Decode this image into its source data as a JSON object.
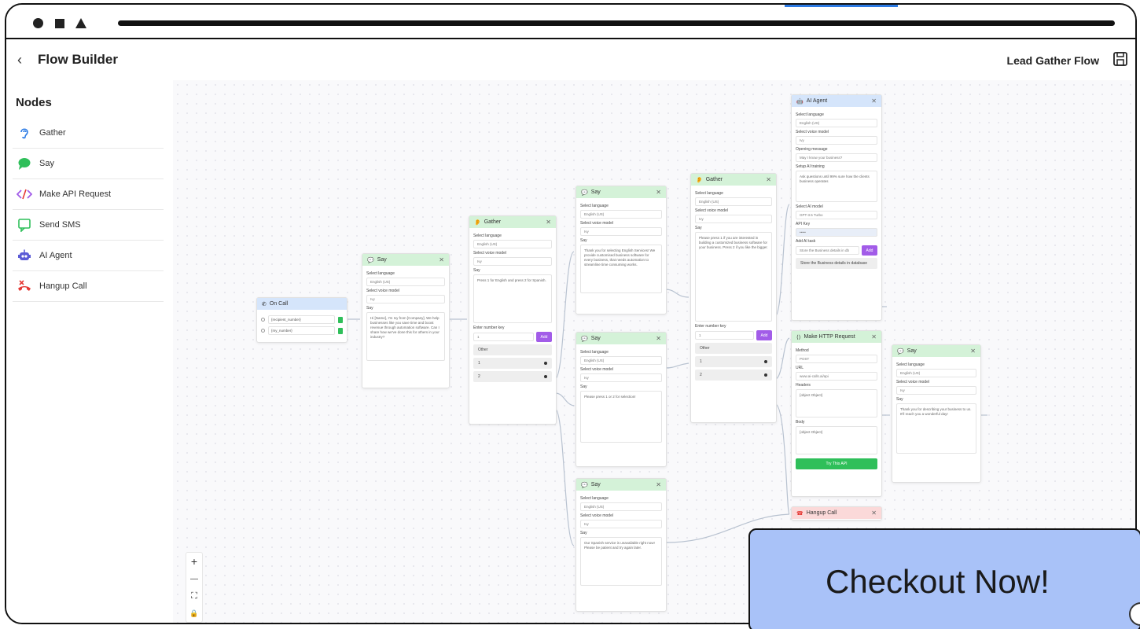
{
  "header": {
    "back_icon": "‹",
    "title": "Flow Builder",
    "flow_name": "Lead Gather Flow"
  },
  "sidebar": {
    "title": "Nodes",
    "items": [
      {
        "label": "Gather",
        "icon": "ear-icon",
        "color": "#2c7be5"
      },
      {
        "label": "Say",
        "icon": "speech-bubble-icon",
        "color": "#2fbf5a"
      },
      {
        "label": "Make API Request",
        "icon": "code-icon",
        "color": "#a25ce8"
      },
      {
        "label": "Send SMS",
        "icon": "message-icon",
        "color": "#2fbf5a"
      },
      {
        "label": "AI Agent",
        "icon": "robot-icon",
        "color": "#5b5bd6"
      },
      {
        "label": "Hangup Call",
        "icon": "hangup-icon",
        "color": "#e53935"
      }
    ]
  },
  "canvas": {
    "oncall": {
      "title": "On Call",
      "vars": [
        "{recipient_number}",
        "{my_number}"
      ]
    },
    "say1": {
      "title": "Say",
      "lang_label": "Select language",
      "lang_value": "English (US)",
      "voice_label": "Select voice model",
      "voice_value": "Ivy",
      "say_label": "Say",
      "say_text": "Hi [Name], I'm Ivy from [Company]. We help businesses like you save time and boost revenue through automation software. Can I share how we've done this for others in your industry?"
    },
    "gather1": {
      "title": "Gather",
      "lang_label": "Select language",
      "lang_value": "English (US)",
      "voice_label": "Select voice model",
      "voice_value": "Ivy",
      "say_label": "Say",
      "say_text": "Press 1 for English and press 2 for Spanish.",
      "key_label": "Enter number key",
      "key_value": "1",
      "add_label": "Add",
      "options": [
        "Other",
        "1",
        "2"
      ]
    },
    "say2": {
      "title": "Say",
      "lang_label": "Select language",
      "lang_value": "English (US)",
      "voice_label": "Select voice model",
      "voice_value": "Ivy",
      "say_label": "Say",
      "say_text": "Thank you for selecting English Services! We provide customised business software for every business, that needs automation to streamline time consuming works."
    },
    "say3": {
      "title": "Say",
      "lang_label": "Select language",
      "lang_value": "English (US)",
      "voice_label": "Select voice model",
      "voice_value": "Ivy",
      "say_label": "Say",
      "say_text": "Please press 1 or 2 for selection!"
    },
    "say4": {
      "title": "Say",
      "lang_label": "Select language",
      "lang_value": "English (US)",
      "voice_label": "Select voice model",
      "voice_value": "Ivy",
      "say_label": "Say",
      "say_text": "Our Spanish service is unavailable right now! Please be patient and try again later."
    },
    "gather2": {
      "title": "Gather",
      "lang_label": "Select language",
      "lang_value": "English (US)",
      "voice_label": "Select voice model",
      "voice_value": "Ivy",
      "say_label": "Say",
      "say_text": "Please press 1 if you are interested in building a customized business software for your business. Press 2 if you like the bigger.",
      "key_label": "Enter number key",
      "key_value": "1",
      "add_label": "Add",
      "options": [
        "Other",
        "1",
        "2"
      ]
    },
    "aiagent": {
      "title": "AI Agent",
      "lang_label": "Select language",
      "lang_value": "English (US)",
      "voice_label": "Select voice model",
      "voice_value": "Ivy",
      "opening_label": "Opening message",
      "opening_value": "May I know your business?",
      "setup_label": "Setup AI training",
      "setup_value": "Ask questions until 99% sure how the clients business operates",
      "model_label": "Select AI model",
      "model_value": "GPT-3.5 Turbo",
      "apikey_label": "API Key",
      "apikey_value": "•••••",
      "task_label": "Add AI task",
      "task_value": "Store the Business details in db",
      "add_label": "Add",
      "task_item": "Store the Business details in database"
    },
    "http": {
      "title": "Make HTTP Request",
      "method_label": "Method",
      "method_value": "POST",
      "url_label": "URL",
      "url_value": "www.ai-calls.ai/api",
      "headers_label": "Headers",
      "headers_value": "{object Object}",
      "body_label": "Body",
      "body_value": "{object Object}",
      "button_label": "Try This API"
    },
    "say5": {
      "title": "Say",
      "lang_label": "Select language",
      "lang_value": "English (US)",
      "voice_label": "Select voice model",
      "voice_value": "Ivy",
      "say_label": "Say",
      "say_text": "Thank you for describing your business to us. It'll reach you a wonderful day!"
    },
    "hangup": {
      "title": "Hangup Call"
    }
  },
  "zoom": {
    "plus": "+",
    "minus": "—",
    "fit": "⛶",
    "lock": "🔒"
  },
  "banner": {
    "label": "Checkout Now!"
  }
}
